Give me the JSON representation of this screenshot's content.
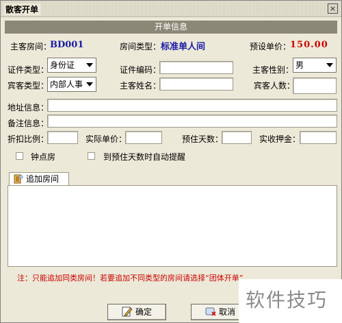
{
  "window": {
    "title": "散客开单",
    "close_symbol": "×"
  },
  "section": {
    "title": "开单信息"
  },
  "row1": {
    "room_label": "主客房间：",
    "room_value": "BD001",
    "room_type_label": "房间类型：",
    "room_type_value": "标准单人间",
    "price_label": "预设单价：",
    "price_value": "150.00"
  },
  "row2": {
    "id_type_label": "证件类型：",
    "id_type_value": "身份证",
    "id_number_label": "证件编码：",
    "id_number_value": "",
    "gender_label": "主客性别：",
    "gender_value": "男"
  },
  "row3": {
    "guest_type_label": "宾客类型：",
    "guest_type_value": "内部人事",
    "guest_name_label": "主客姓名：",
    "guest_name_value": "",
    "guest_count_label": "宾客人数：",
    "guest_count_value": ""
  },
  "row4": {
    "address_label": "地址信息：",
    "address_value": ""
  },
  "row5": {
    "remark_label": "备注信息：",
    "remark_value": ""
  },
  "row6": {
    "discount_label": "折扣比例：",
    "discount_value": "",
    "actual_price_label": "实际单价：",
    "actual_price_value": "",
    "days_label": "预住天数：",
    "days_value": "",
    "deposit_label": "实收押金：",
    "deposit_value": ""
  },
  "options": {
    "hourly_label": "钟点房",
    "reminder_label": "到预住天数时自动提醒"
  },
  "tabs": {
    "add_room_label": "追加房间"
  },
  "note": "注：只能追加同类房间！若要追加不同类型的房间请选择“团体开单”",
  "buttons": {
    "confirm_label": "确定",
    "cancel_label": "取消"
  },
  "watermark": "软件技巧"
}
